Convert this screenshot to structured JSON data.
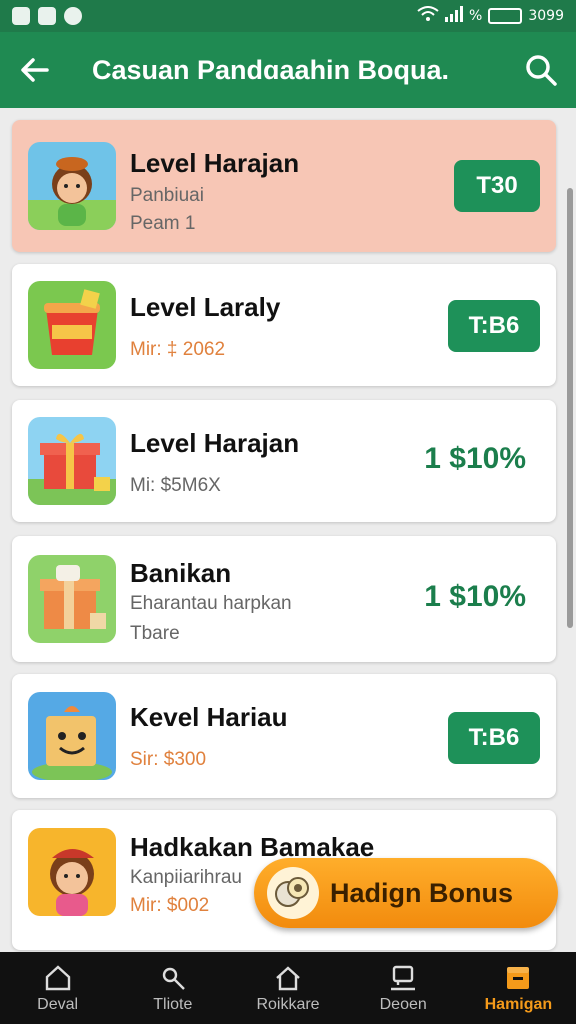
{
  "status_bar": {
    "signal_text": "%",
    "battery_text": "3099"
  },
  "app_bar": {
    "title": "Casuan Pandɑaahin Boqua."
  },
  "items": [
    {
      "name": "Level Harajan",
      "sub": "Panbiuai",
      "meta": "Peam 1",
      "action": "T30",
      "action_style": "button",
      "icon": "girl-character-icon"
    },
    {
      "name": "Level Laraly",
      "sub": "",
      "meta": "Mir: ‡ 2062",
      "action": "T:B6",
      "action_style": "button",
      "icon": "red-bucket-icon"
    },
    {
      "name": "Level Harajan",
      "sub": "",
      "meta": "Mi: $5M6X",
      "action": "1 $10%",
      "action_style": "text",
      "icon": "gift-box-icon"
    },
    {
      "name": "Banikan",
      "sub": "Eharantau harpkan",
      "meta": "Tbare",
      "action": "1 $10%",
      "action_style": "text",
      "icon": "package-box-icon"
    },
    {
      "name": "Kevel Hariau",
      "sub": "",
      "meta": "Sir: $300",
      "action": "T:B6",
      "action_style": "button",
      "icon": "box-character-icon"
    },
    {
      "name": "Hadkakan Bamakae",
      "sub": "Kanpiiarihrau",
      "meta": "Mir: $002",
      "action": "",
      "action_style": "none",
      "icon": "girl-hat-icon"
    }
  ],
  "fab": {
    "label": "Hadign Bonus",
    "icon": "coins-icon"
  },
  "nav": [
    {
      "label": "Deval",
      "icon": "home-icon"
    },
    {
      "label": "Tliote",
      "icon": "tools-icon"
    },
    {
      "label": "Roikkare",
      "icon": "house-icon"
    },
    {
      "label": "Deoen",
      "icon": "chat-icon"
    },
    {
      "label": "Hamigan",
      "icon": "bonus-icon",
      "active": true
    }
  ],
  "colors": {
    "primary": "#1f8a52",
    "accent": "#f49a1a",
    "highlight": "#f7c6b5",
    "price": "#1b7e4c"
  }
}
